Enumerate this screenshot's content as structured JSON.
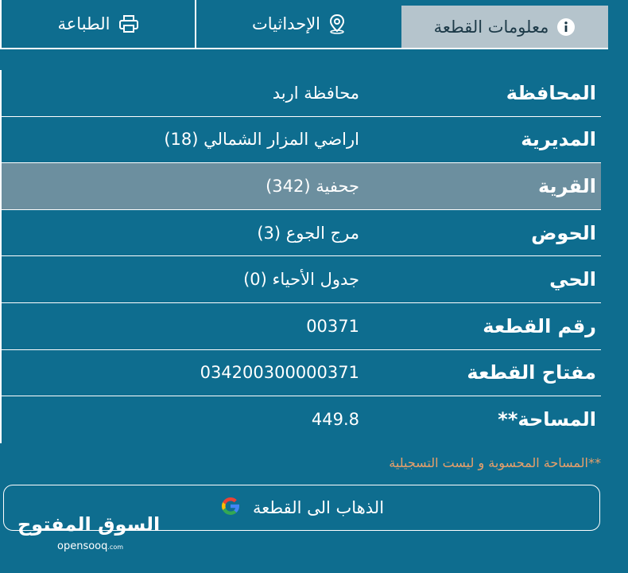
{
  "tabs": [
    {
      "label": "معلومات القطعة",
      "icon": "info-icon",
      "active": true
    },
    {
      "label": "الإحداثيات",
      "icon": "location-pin-icon",
      "active": false
    },
    {
      "label": "الطباعة",
      "icon": "printer-icon",
      "active": false
    }
  ],
  "rows": [
    {
      "label": "المحافظة",
      "value": "محافظة اربد"
    },
    {
      "label": "المديرية",
      "value": "اراضي المزار الشمالي (18)"
    },
    {
      "label": "القرية",
      "value": "جحفية (342)"
    },
    {
      "label": "الحوض",
      "value": "مرج الجوع (3)"
    },
    {
      "label": "الحي",
      "value": "جدول الأحياء (0)"
    },
    {
      "label": "رقم القطعة",
      "value": "00371"
    },
    {
      "label": "مفتاح القطعة",
      "value": "034200300000371"
    },
    {
      "label": "المساحة**",
      "value": "449.8"
    }
  ],
  "note": "**المساحة المحسوبة و ليست التسجيلية",
  "goto_button": {
    "label": "الذهاب الى القطعة",
    "icon": "google-icon"
  },
  "watermark": {
    "arabic": "السوق المفتوح",
    "latin": "opensooq",
    "latin_suffix": ".com"
  },
  "colors": {
    "background": "#0e6d8f",
    "active_tab": "#b5c4cc",
    "highlight_row": "#6c8f9f",
    "note": "#e9a06a"
  }
}
